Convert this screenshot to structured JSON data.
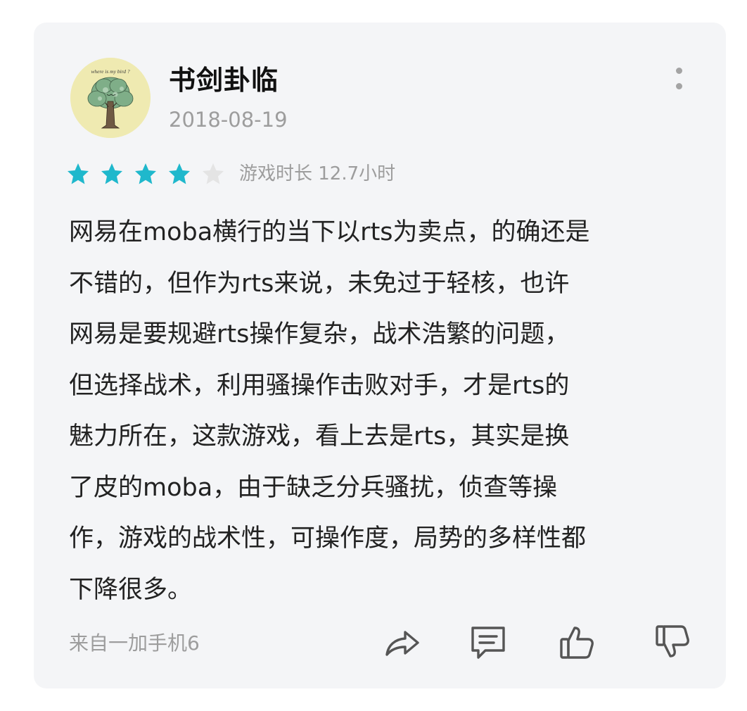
{
  "review": {
    "user": {
      "name": "书剑卦临",
      "avatar_text": "where is my bird ?"
    },
    "date": "2018-08-19",
    "rating": {
      "value": 4,
      "max": 5,
      "filled_color": "#1fb8cc",
      "empty_color": "#e4e4e4"
    },
    "playtime": "游戏时长 12.7小时",
    "body": "网易在moba横行的当下以rts为卖点，的确还是\n不错的，但作为rts来说，未免过于轻核，也许\n网易是要规避rts操作复杂，战术浩繁的问题，\n但选择战术，利用骚操作击败对手，才是rts的\n魅力所在，这款游戏，看上去是rts，其实是换\n了皮的moba，由于缺乏分兵骚扰，侦查等操\n作，游戏的战术性，可操作度，局势的多样性都\n下降很多。",
    "device": "来自一加手机6"
  },
  "actions": [
    {
      "icon": "share-icon"
    },
    {
      "icon": "comment-icon"
    },
    {
      "icon": "thumbs-up-icon"
    },
    {
      "icon": "thumbs-down-icon"
    }
  ],
  "menu": {
    "icon": "more-vertical-icon"
  }
}
